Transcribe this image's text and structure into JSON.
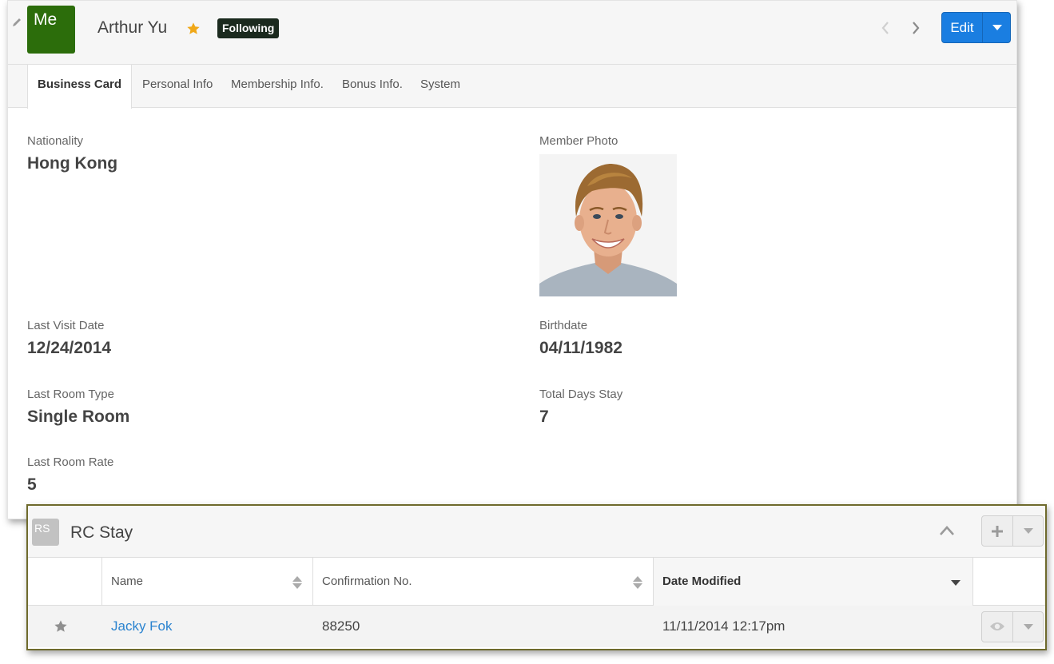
{
  "header": {
    "avatar_text": "Me",
    "record_name": "Arthur Yu",
    "follow_label": "Following",
    "edit_label": "Edit"
  },
  "tabs": [
    {
      "label": "Business Card",
      "active": true
    },
    {
      "label": "Personal Info",
      "active": false
    },
    {
      "label": "Membership Info.",
      "active": false
    },
    {
      "label": "Bonus Info.",
      "active": false
    },
    {
      "label": "System",
      "active": false
    }
  ],
  "fields": {
    "nationality": {
      "label": "Nationality",
      "value": "Hong Kong"
    },
    "member_photo": {
      "label": "Member Photo"
    },
    "last_visit_date": {
      "label": "Last Visit Date",
      "value": "12/24/2014"
    },
    "birthdate": {
      "label": "Birthdate",
      "value": "04/11/1982"
    },
    "last_room_type": {
      "label": "Last Room Type",
      "value": "Single Room"
    },
    "total_days_stay": {
      "label": "Total Days Stay",
      "value": "7"
    },
    "last_room_rate": {
      "label": "Last Room Rate",
      "value": "5"
    }
  },
  "subpanel": {
    "icon_text": "RS",
    "title": "RC Stay",
    "columns": [
      {
        "label": "Name"
      },
      {
        "label": "Confirmation No."
      },
      {
        "label": "Date Modified"
      }
    ],
    "rows": [
      {
        "name": "Jacky Fok",
        "confirmation_no": "88250",
        "date_modified": "11/11/2014 12:17pm"
      }
    ]
  },
  "colors": {
    "avatar_bg": "#2c6d0b",
    "primary_button": "#1a7ee1",
    "star_active": "#f0a818",
    "link": "#2a83cf",
    "subpanel_border": "#6e6a2c"
  }
}
